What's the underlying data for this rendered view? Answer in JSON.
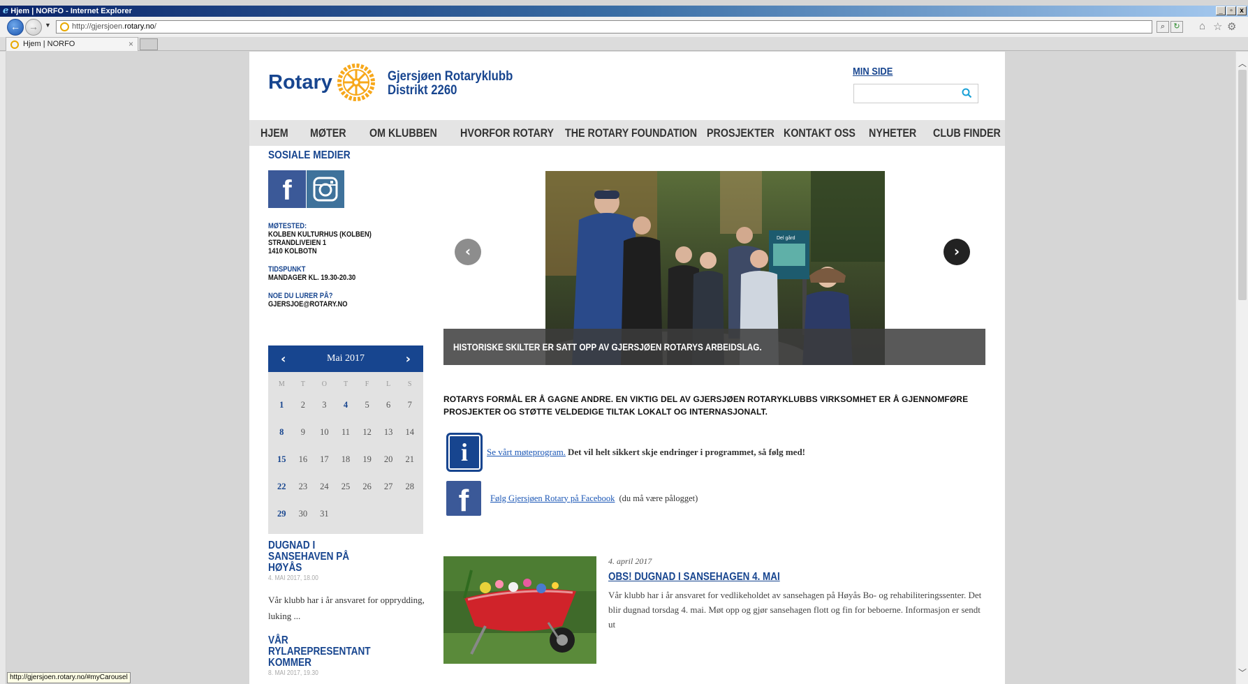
{
  "browser": {
    "title": "Hjem | NORFO - Internet Explorer",
    "url_prefix": "http://gjersjoen.",
    "url_host": "rotary.no",
    "url_suffix": "/",
    "tab_label": "Hjem | NORFO",
    "status_url": "http://gjersjoen.rotary.no/#myCarousel"
  },
  "header": {
    "logo_text": "Rotary",
    "club_name": "Gjersjøen Rotaryklubb",
    "district": "Distrikt 2260",
    "min_side": "MIN SIDE",
    "search_placeholder": ""
  },
  "nav": [
    "HJEM",
    "MØTER",
    "OM KLUBBEN",
    "HVORFOR ROTARY",
    "THE ROTARY FOUNDATION",
    "PROSJEKTER",
    "KONTAKT OSS",
    "NYHETER",
    "CLUB FINDER"
  ],
  "sidebar": {
    "social_heading": "SOSIALE MEDIER",
    "meeting_label": "MØTESTED:",
    "meeting_lines": [
      "KOLBEN KULTURHUS (KOLBEN)",
      "STRANDLIVEIEN 1",
      "1410 KOLBOTN"
    ],
    "time_label": "TIDSPUNKT",
    "time_value": "MANDAGER KL. 19.30-20.30",
    "question_label": "NOE DU LURER PÅ?",
    "email": "GJERSJOE@ROTARY.NO"
  },
  "calendar": {
    "month": "Mai 2017",
    "weekdays": [
      "M",
      "T",
      "O",
      "T",
      "F",
      "L",
      "S"
    ],
    "days": [
      "1",
      "2",
      "3",
      "4",
      "5",
      "6",
      "7",
      "8",
      "9",
      "10",
      "11",
      "12",
      "13",
      "14",
      "15",
      "16",
      "17",
      "18",
      "19",
      "20",
      "21",
      "22",
      "23",
      "24",
      "25",
      "26",
      "27",
      "28",
      "29",
      "30",
      "31"
    ],
    "bold_days": [
      "1",
      "4",
      "8",
      "15",
      "22",
      "29"
    ]
  },
  "sidebar_news": [
    {
      "title": "DUGNAD I SANSEHAVEN PÅ HØYÅS",
      "date": "4. MAI 2017, 18.00",
      "text": "Vår klubb har i år ansvaret for opprydding, luking ..."
    },
    {
      "title": "VÅR RYLAREPRESENTANT KOMMER",
      "date": "8. MAI 2017, 19.30",
      "text": ""
    }
  ],
  "carousel": {
    "caption": "HISTORISKE SKILTER ER SATT OPP AV GJERSJØEN ROTARYS ARBEIDSLAG.",
    "sign_text": "Del gård"
  },
  "main": {
    "purpose": "ROTARYS FORMÅL ER Å GAGNE ANDRE. EN VIKTIG DEL AV GJERSJØEN ROTARYKLUBBS VIRKSOMHET ER Å GJENNOMFØRE PROSJEKTER OG STØTTE VELDEDIGE TILTAK LOKALT OG INTERNASJONALT.",
    "program_link": "Se vårt møteprogram.",
    "program_text": "Det vil helt sikkert skje endringer i programmet, så følg med!",
    "facebook_link": "Følg Gjersjøen Rotary på Facebook",
    "facebook_text": "(du må være pålogget)"
  },
  "article": {
    "date": "4. april 2017",
    "title": "OBS! DUGNAD I SANSEHAGEN 4. MAI",
    "text": "Vår klubb har i år ansvaret for vedlikeholdet av sansehagen på Høyås Bo- og rehabiliteringssenter. Det blir dugnad torsdag 4. mai. Møt opp og gjør sansehagen flott og fin for beboerne. Informasjon er sendt ut"
  },
  "colors": {
    "rotary_blue": "#17458f",
    "rotary_gold": "#f7a81b",
    "facebook_blue": "#3b5998"
  }
}
